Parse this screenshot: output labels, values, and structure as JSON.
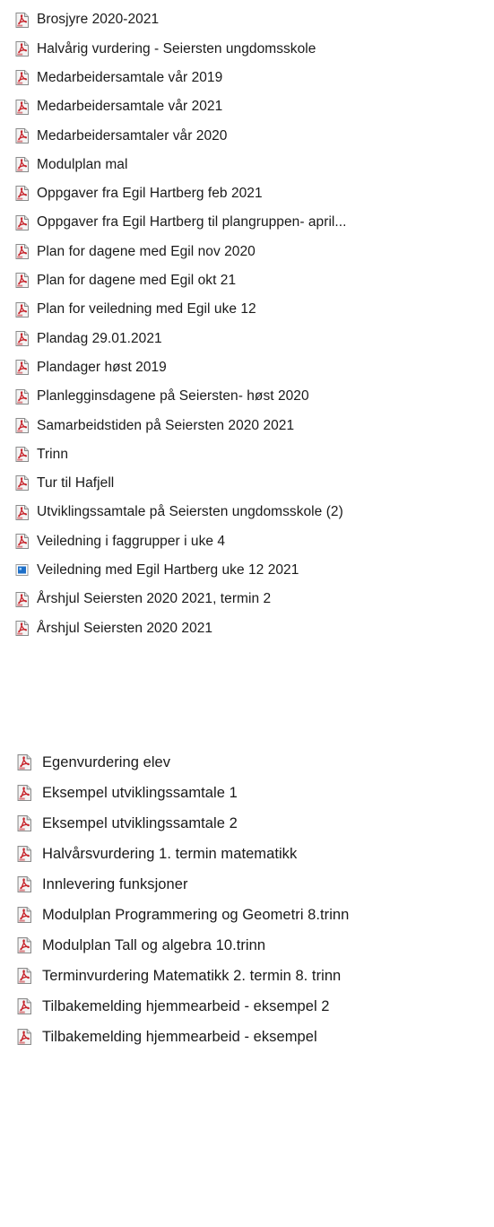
{
  "top_list": {
    "items": [
      {
        "label": "Brosjyre 2020-2021",
        "icon": "pdf-file-icon"
      },
      {
        "label": "Halvårig vurdering - Seiersten ungdomsskole",
        "icon": "pdf-file-icon"
      },
      {
        "label": "Medarbeidersamtale vår 2019",
        "icon": "pdf-file-icon"
      },
      {
        "label": "Medarbeidersamtale vår 2021",
        "icon": "pdf-file-icon"
      },
      {
        "label": "Medarbeidersamtaler vår 2020",
        "icon": "pdf-file-icon"
      },
      {
        "label": "Modulplan mal",
        "icon": "pdf-file-icon"
      },
      {
        "label": "Oppgaver fra Egil Hartberg feb 2021",
        "icon": "pdf-file-icon"
      },
      {
        "label": "Oppgaver fra Egil Hartberg til plangruppen- april...",
        "icon": "pdf-file-icon"
      },
      {
        "label": "Plan for dagene med Egil nov 2020",
        "icon": "pdf-file-icon"
      },
      {
        "label": "Plan for dagene med Egil okt 21",
        "icon": "pdf-file-icon"
      },
      {
        "label": "Plan for veiledning med Egil uke 12",
        "icon": "pdf-file-icon"
      },
      {
        "label": "Plandag 29.01.2021",
        "icon": "pdf-file-icon"
      },
      {
        "label": "Plandager høst 2019",
        "icon": "pdf-file-icon"
      },
      {
        "label": "Planlegginsdagene på Seiersten- høst 2020",
        "icon": "pdf-file-icon"
      },
      {
        "label": "Samarbeidstiden på Seiersten 2020 2021",
        "icon": "pdf-file-icon"
      },
      {
        "label": "Trinn",
        "icon": "pdf-file-icon"
      },
      {
        "label": "Tur til Hafjell",
        "icon": "pdf-file-icon"
      },
      {
        "label": "Utviklingssamtale på Seiersten ungdomsskole (2)",
        "icon": "pdf-file-icon"
      },
      {
        "label": "Veiledning i faggrupper i uke 4",
        "icon": "pdf-file-icon"
      },
      {
        "label": "Veiledning med Egil Hartberg uke 12 2021",
        "icon": "image-file-icon"
      },
      {
        "label": "Årshjul Seiersten 2020 2021, termin 2",
        "icon": "pdf-file-icon"
      },
      {
        "label": "Årshjul Seiersten 2020 2021",
        "icon": "pdf-file-icon"
      }
    ]
  },
  "bottom_list": {
    "items": [
      {
        "label": "Egenvurdering elev",
        "icon": "pdf-file-icon"
      },
      {
        "label": "Eksempel utviklingssamtale 1",
        "icon": "pdf-file-icon"
      },
      {
        "label": "Eksempel utviklingssamtale 2",
        "icon": "pdf-file-icon"
      },
      {
        "label": "Halvårsvurdering 1. termin matematikk",
        "icon": "pdf-file-icon"
      },
      {
        "label": "Innlevering funksjoner",
        "icon": "pdf-file-icon"
      },
      {
        "label": "Modulplan Programmering og Geometri 8.trinn",
        "icon": "pdf-file-icon"
      },
      {
        "label": "Modulplan Tall og algebra 10.trinn",
        "icon": "pdf-file-icon"
      },
      {
        "label": "Terminvurdering Matematikk 2. termin 8. trinn",
        "icon": "pdf-file-icon"
      },
      {
        "label": "Tilbakemelding hjemmearbeid - eksempel 2",
        "icon": "pdf-file-icon"
      },
      {
        "label": "Tilbakemelding hjemmearbeid - eksempel",
        "icon": "pdf-file-icon"
      }
    ]
  },
  "colors": {
    "pdf_icon_red": "#c7252c",
    "pdf_icon_page": "#f4f4f4",
    "pdf_icon_border": "#8a8a8a",
    "image_icon_blue": "#1e6fc8",
    "text": "#1a1a1a"
  }
}
